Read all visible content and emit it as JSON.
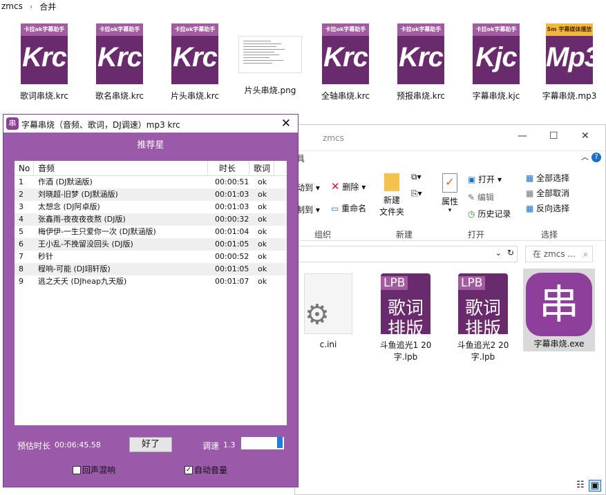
{
  "breadcrumb": {
    "seg1": "zmcs",
    "seg2": "合并"
  },
  "top_files": [
    {
      "band": "卡拉ok字幕助手",
      "ext": "Krc",
      "label": "歌词串烧.krc"
    },
    {
      "band": "卡拉ok字幕助手",
      "ext": "Krc",
      "label": "歌名串烧.krc"
    },
    {
      "band": "卡拉ok字幕助手",
      "ext": "Krc",
      "label": "片头串烧.krc"
    },
    {
      "label": "片头串烧.png"
    },
    {
      "band": "卡拉ok字幕助手",
      "ext": "Krc",
      "label": "全轴串烧.krc"
    },
    {
      "band": "卡拉ok字幕助手",
      "ext": "Krc",
      "label": "预报串烧.krc"
    },
    {
      "band": "卡拉ok字幕助手",
      "ext": "Kjc",
      "label": "字幕串烧.kjc"
    },
    {
      "band": "Sm 字幕媒体播放",
      "ext": "Mp3",
      "label": "字幕串烧.mp3"
    }
  ],
  "explorer": {
    "title": "zmcs",
    "ribbon": {
      "move": "动到",
      "copy": "制到",
      "delete": "删除",
      "rename": "重命名",
      "newfolder1": "新建",
      "newfolder2": "文件夹",
      "props": "属性",
      "open": "打开",
      "edit": "编辑",
      "history": "历史记录",
      "selall": "全部选择",
      "selnone": "全部取消",
      "selinv": "反向选择",
      "g_org": "组织",
      "g_new": "新建",
      "g_open": "打开",
      "g_sel": "选择"
    },
    "search_placeholder": "在 zmcs ...",
    "files": [
      {
        "label": "c.ini"
      },
      {
        "tag": "LPB",
        "l1": "歌词",
        "l2": "排版",
        "label": "斗鱼追光1 20字.lpb"
      },
      {
        "tag": "LPB",
        "l1": "歌词",
        "l2": "排版",
        "label": "斗鱼追光2 20字.lpb"
      },
      {
        "label": "字幕串烧.exe"
      }
    ]
  },
  "dialog": {
    "icon": "串",
    "title": "字幕串烧（音频、歌词，DJ调速）mp3 krc",
    "header": "推荐星",
    "columns": [
      "No",
      "音频",
      "时长",
      "歌词"
    ],
    "rows": [
      {
        "no": "1",
        "name": "作酒 (DJ默涵版)",
        "dur": "00:00:51",
        "lyr": "ok"
      },
      {
        "no": "2",
        "name": "刘晓超-旧梦 (DJ默涵版)",
        "dur": "00:01:03",
        "lyr": "ok"
      },
      {
        "no": "3",
        "name": "太想念 (DJ阿卓版)",
        "dur": "00:01:03",
        "lyr": "ok"
      },
      {
        "no": "4",
        "name": "张鑫雨-夜夜夜夜熬 (DJ版)",
        "dur": "00:00:32",
        "lyr": "ok"
      },
      {
        "no": "5",
        "name": "梅伊伊-一生只爱你一次 (DJ默涵版)",
        "dur": "00:01:04",
        "lyr": "ok"
      },
      {
        "no": "6",
        "name": "王小乱-不挽留没回头 (DJ版)",
        "dur": "00:01:05",
        "lyr": "ok"
      },
      {
        "no": "7",
        "name": "秒针",
        "dur": "00:00:52",
        "lyr": "ok"
      },
      {
        "no": "8",
        "name": "程响-可能 (DJ翊轩版)",
        "dur": "00:01:05",
        "lyr": "ok"
      },
      {
        "no": "9",
        "name": "逃之夭夭 (DJheap九天版)",
        "dur": "00:01:07",
        "lyr": "ok"
      }
    ],
    "est_label": "预估时长",
    "est_value": "00:06:45.58",
    "ok_button": "好了",
    "speed_label": "调速",
    "speed_value": "1.3",
    "echo_label": "回声混响",
    "echo_checked": false,
    "auto_label": "自动音量",
    "auto_checked": true
  }
}
